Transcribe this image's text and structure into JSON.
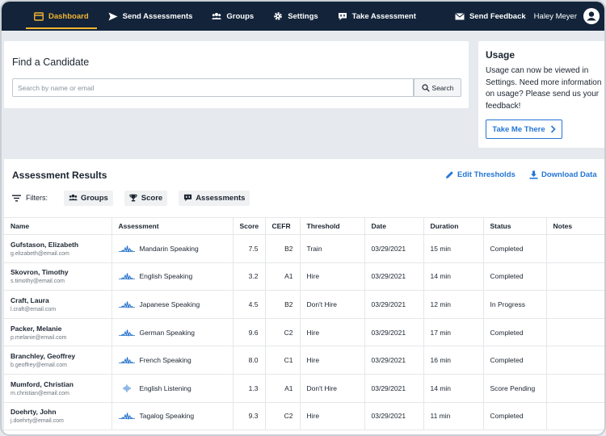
{
  "nav": {
    "items": [
      {
        "label": "Dashboard",
        "icon": "dashboard-icon",
        "active": true
      },
      {
        "label": "Send Assessments",
        "icon": "send-icon",
        "active": false
      },
      {
        "label": "Groups",
        "icon": "groups-icon",
        "active": false
      },
      {
        "label": "Settings",
        "icon": "gear-icon",
        "active": false
      },
      {
        "label": "Take Assessment",
        "icon": "chat-icon",
        "active": false
      }
    ],
    "feedback_label": "Send Feedback",
    "user_name": "Haley Meyer",
    "accent_color": "#f2b530",
    "background_color": "#13243a"
  },
  "find": {
    "title": "Find a Candidate",
    "search_placeholder": "Search by name or email",
    "search_button": "Search"
  },
  "usage": {
    "title": "Usage",
    "text": "Usage can now be viewed in Settings. Need more information on usage? Please send us your feedback!",
    "button_label": "Take Me There"
  },
  "results": {
    "title": "Assessment Results",
    "edit_thresholds": "Edit Thresholds",
    "download_data": "Download Data",
    "filters_label": "Filters:",
    "filter_chips": [
      "Groups",
      "Score",
      "Assessments"
    ],
    "columns": [
      "Name",
      "Assessment",
      "Score",
      "CEFR",
      "Threshold",
      "Date",
      "Duration",
      "Status",
      "Notes"
    ],
    "rows": [
      {
        "name": "Gufstason, Elizabeth",
        "email": "g.elizabeth@email.com",
        "assessment": "Mandarin Speaking",
        "type": "speaking",
        "score": "7.5",
        "cefr": "B2",
        "threshold": "Train",
        "date": "03/29/2021",
        "duration": "15 min",
        "status": "Completed",
        "notes": ""
      },
      {
        "name": "Skovron, Timothy",
        "email": "s.timothy@email.com",
        "assessment": "English Speaking",
        "type": "speaking",
        "score": "3.2",
        "cefr": "A1",
        "threshold": "Hire",
        "date": "03/29/2021",
        "duration": "14 min",
        "status": "Completed",
        "notes": ""
      },
      {
        "name": "Craft, Laura",
        "email": "l.craft@email.com",
        "assessment": "Japanese Speaking",
        "type": "speaking",
        "score": "4.5",
        "cefr": "B2",
        "threshold": "Don't Hire",
        "date": "03/29/2021",
        "duration": "12 min",
        "status": "In Progress",
        "notes": ""
      },
      {
        "name": "Packer, Melanie",
        "email": "p.melanie@email.com",
        "assessment": "German Speaking",
        "type": "speaking",
        "score": "9.6",
        "cefr": "C2",
        "threshold": "Hire",
        "date": "03/29/2021",
        "duration": "17 min",
        "status": "Completed",
        "notes": ""
      },
      {
        "name": "Branchley, Geoffrey",
        "email": "b.geoffrey@email.com",
        "assessment": "French Speaking",
        "type": "speaking",
        "score": "8.0",
        "cefr": "C1",
        "threshold": "Hire",
        "date": "03/29/2021",
        "duration": "16 min",
        "status": "Completed",
        "notes": ""
      },
      {
        "name": "Mumford, Christian",
        "email": "m.christian@email.com",
        "assessment": "English Listening",
        "type": "listening",
        "score": "1.3",
        "cefr": "A1",
        "threshold": "Don't Hire",
        "date": "03/29/2021",
        "duration": "14 min",
        "status": "Score Pending",
        "notes": ""
      },
      {
        "name": "Doehrty, John",
        "email": "j.doehrty@email.com",
        "assessment": "Tagalog Speaking",
        "type": "speaking",
        "score": "9.3",
        "cefr": "C2",
        "threshold": "Hire",
        "date": "03/29/2021",
        "duration": "11 min",
        "status": "Completed",
        "notes": ""
      }
    ],
    "link_color": "#2376d4"
  }
}
